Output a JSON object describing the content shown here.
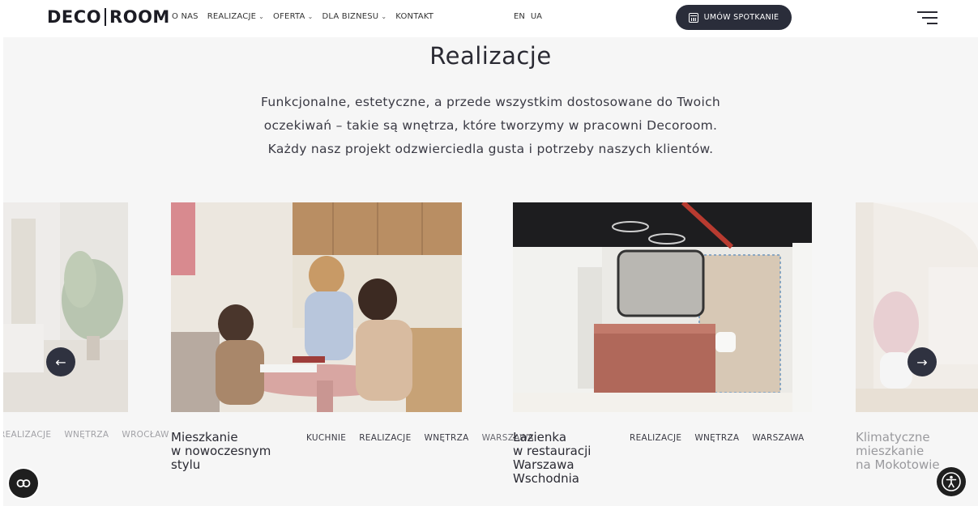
{
  "header": {
    "logo_left": "DECO",
    "logo_right": "ROOM",
    "nav": [
      {
        "label": "O NAS",
        "dropdown": false
      },
      {
        "label": "REALIZACJE",
        "dropdown": true
      },
      {
        "label": "OFERTA",
        "dropdown": true
      },
      {
        "label": "DLA BIZNESU",
        "dropdown": true
      },
      {
        "label": "KONTAKT",
        "dropdown": false
      }
    ],
    "languages": [
      "EN",
      "UA"
    ],
    "cta_label": "UMÓW SPOTKANIE",
    "cta_icon": "calendar-icon",
    "menu_icon": "hamburger-menu-icon"
  },
  "section": {
    "title": "Realizacje",
    "description": [
      "Funkcjonalne, estetyczne, a przede wszystkim dostosowane do Twoich",
      "oczekiwań – takie są wnętrza, które tworzymy w pracowni Decoroom.",
      "Każdy nasz projekt odzwierciedla gusta i potrzeby naszych klientów."
    ]
  },
  "cards": [
    {
      "title_lines": [],
      "tags": [
        "REALIZACJE",
        "WNĘTRZA",
        "WROCŁAW"
      ],
      "image": "living-room-photo"
    },
    {
      "title_lines": [
        "Mieszkanie",
        "w nowoczesnym",
        "stylu"
      ],
      "tags": [
        "KUCHNIE",
        "REALIZACJE",
        "WNĘTRZA",
        "WARSZAWA"
      ],
      "image": "kitchen-meeting-photo"
    },
    {
      "title_lines": [
        "Łazienka",
        "w restauracji",
        "Warszawa",
        "Wschodnia"
      ],
      "tags": [
        "REALIZACJE",
        "WNĘTRZA",
        "WARSZAWA"
      ],
      "image": "restaurant-bathroom-photo"
    },
    {
      "title_lines": [
        "Klimatyczne",
        "mieszkanie",
        "na Mokotowie"
      ],
      "tags": [],
      "image": "apartment-photo"
    }
  ],
  "controls": {
    "prev_icon": "arrow-left-icon",
    "next_icon": "arrow-right-icon",
    "cookie_icon": "cookie-settings-icon",
    "accessibility_icon": "accessibility-icon"
  },
  "colors": {
    "accent_dark": "#2a2d3a",
    "background": "#f6f6f6",
    "text": "#2a2a33"
  }
}
